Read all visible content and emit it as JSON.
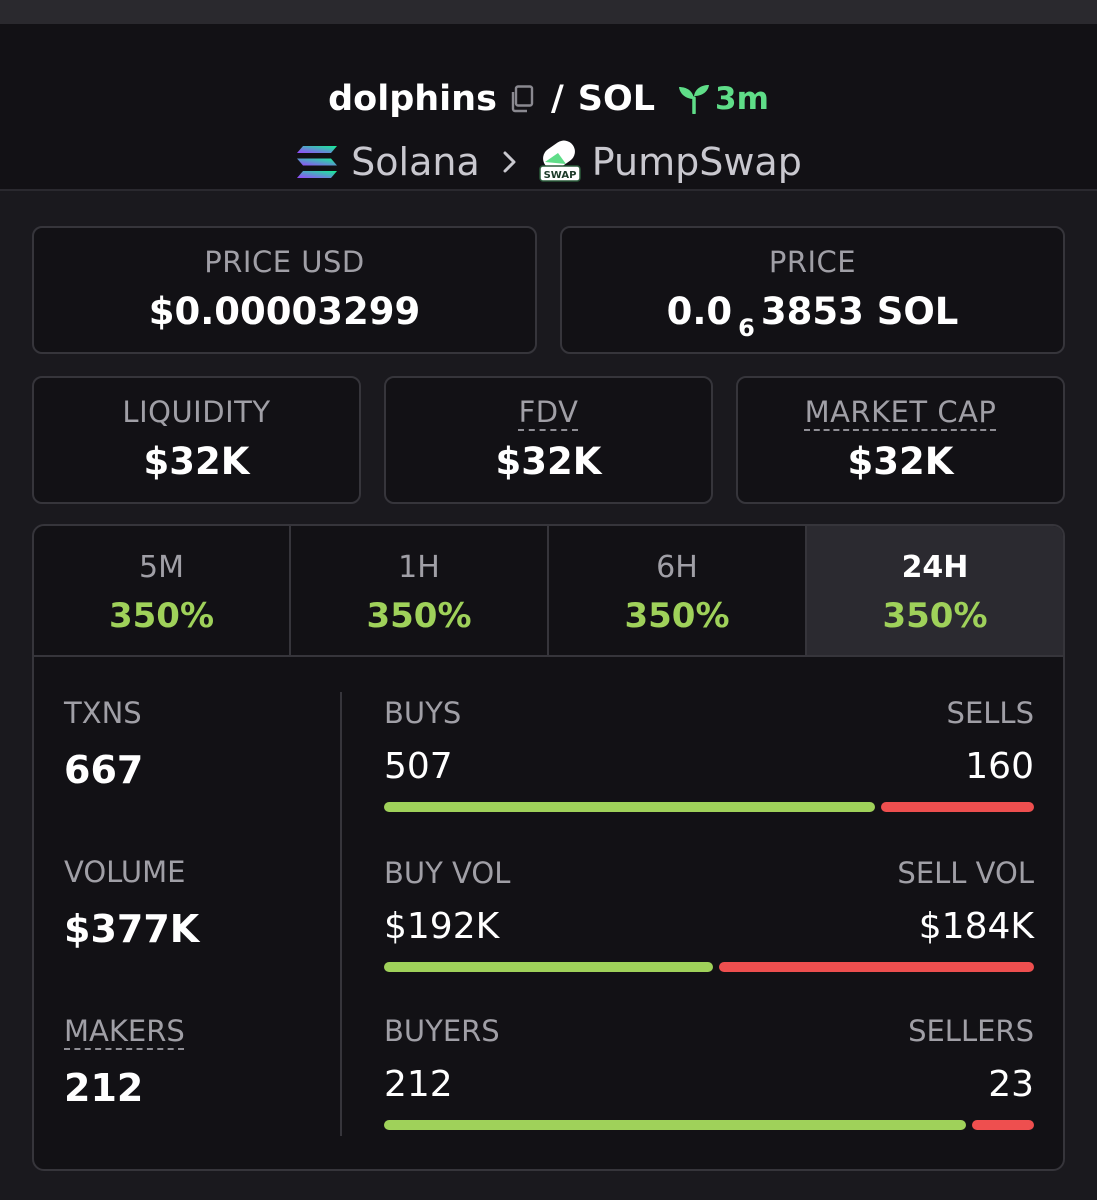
{
  "pair": {
    "token": "dolphins",
    "quote": "SOL",
    "separator": "/",
    "age": "3m"
  },
  "chain": {
    "name": "Solana",
    "dex": "PumpSwap",
    "dex_badge": "SWAP"
  },
  "cards": {
    "price_usd": {
      "label": "PRICE USD",
      "value": "$0.00003299"
    },
    "price": {
      "label": "PRICE",
      "value_prefix": "0.0",
      "value_sub": "6",
      "value_suffix": "3853 SOL"
    },
    "liquidity": {
      "label": "LIQUIDITY",
      "value": "$32K"
    },
    "fdv": {
      "label": "FDV",
      "value": "$32K"
    },
    "market_cap": {
      "label": "MARKET CAP",
      "value": "$32K"
    }
  },
  "tabs": [
    {
      "label": "5M",
      "value": "350%"
    },
    {
      "label": "1H",
      "value": "350%"
    },
    {
      "label": "6H",
      "value": "350%"
    },
    {
      "label": "24H",
      "value": "350%",
      "active": true
    }
  ],
  "stats": {
    "txns": {
      "label": "TXNS",
      "value": "667"
    },
    "volume": {
      "label": "VOLUME",
      "value": "$377K"
    },
    "makers": {
      "label": "MAKERS",
      "value": "212"
    }
  },
  "ratios": {
    "buys_sells": {
      "left_label": "BUYS",
      "right_label": "SELLS",
      "left_value": "507",
      "right_value": "160",
      "left_fraction": 0.76
    },
    "vol": {
      "left_label": "BUY VOL",
      "right_label": "SELL VOL",
      "left_value": "$192K",
      "right_value": "$184K",
      "left_fraction": 0.51
    },
    "buyers_sellers": {
      "left_label": "BUYERS",
      "right_label": "SELLERS",
      "left_value": "212",
      "right_value": "23",
      "left_fraction": 0.9
    }
  },
  "colors": {
    "positive": "#9fd15a",
    "negative": "#ee4f4f",
    "age_green": "#5fdd88",
    "background": "#1a191e",
    "panel": "#121115",
    "border": "#36353b"
  },
  "icons": [
    "copy-icon",
    "sprout-icon",
    "solana-logo",
    "chevron-right-icon",
    "pumpswap-logo"
  ]
}
